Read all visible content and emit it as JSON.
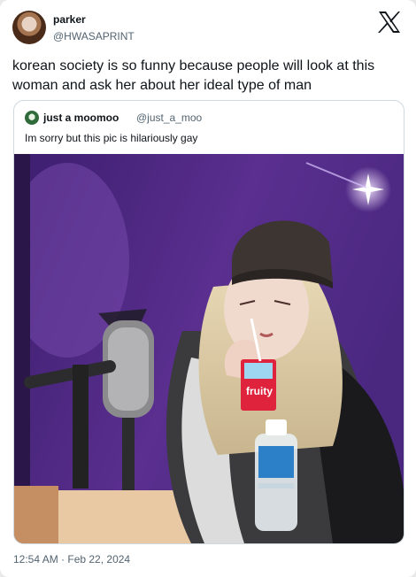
{
  "tweet": {
    "author_name": "parker",
    "author_handle": "@HWASAPRINT",
    "text": "korean society is so funny because people will look at this woman and ask her about her ideal type of man",
    "timestamp": "12:54 AM · Feb 22, 2024"
  },
  "quoted_tweet": {
    "author_name": "just a moomoo",
    "author_handle": "@just_a_moo",
    "text": "Im sorry but this pic is hilariously gay"
  },
  "icons": {
    "platform_logo": "x-logo-icon",
    "author_avatar": "avatar",
    "quoted_avatar": "avatar"
  },
  "colors": {
    "text_primary": "#0f1419",
    "text_secondary": "#536471",
    "border": "#cfd9de",
    "photo_background": "#5a2f8f"
  }
}
